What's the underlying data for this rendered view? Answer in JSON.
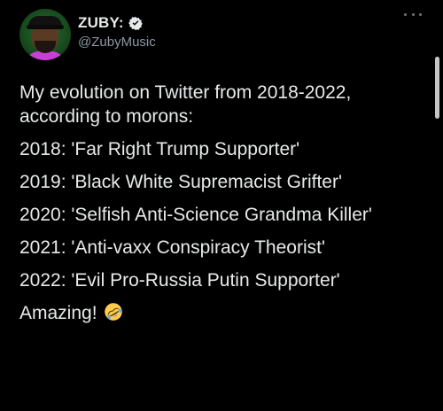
{
  "author": {
    "display_name": "ZUBY:",
    "handle": "@ZubyMusic",
    "verified": true,
    "avatar_icon": "profile-avatar"
  },
  "menu": {
    "icon": "more-options-icon"
  },
  "tweet": {
    "lines": [
      "My evolution on Twitter from 2018-2022, according to morons:",
      "2018: 'Far Right Trump Supporter'",
      "2019: 'Black White Supremacist Grifter'",
      "2020: 'Selfish Anti-Science Grandma Killer'",
      "2021: 'Anti-vaxx Conspiracy Theorist'",
      "2022: 'Evil Pro-Russia Putin Supporter'",
      "Amazing!"
    ],
    "closing_emoji": "rolling-on-floor-laughing"
  },
  "colors": {
    "background": "#000000",
    "text": "#e7e9ea",
    "secondary": "#8b98a5"
  }
}
